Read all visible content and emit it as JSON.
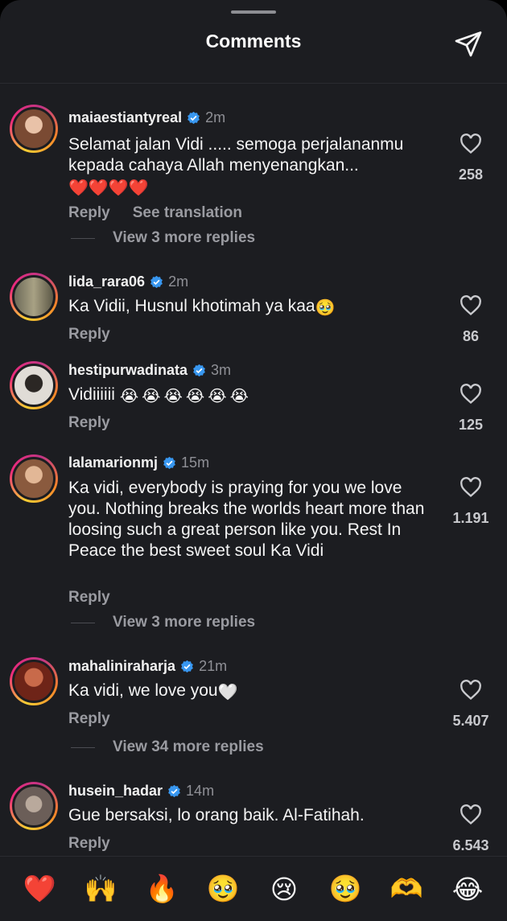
{
  "header": {
    "title": "Comments",
    "share_icon": "paper-plane-icon"
  },
  "comments": [
    {
      "username": "maiaestiantyreal",
      "verified": true,
      "time": "2m",
      "text": "Selamat jalan Vidi ..... semoga perjalananmu kepada cahaya Allah menyenangkan...",
      "text_emoji": "❤️❤️❤️❤️",
      "reply": "Reply",
      "translate": "See translation",
      "view_replies": "View 3 more replies",
      "likes": "258",
      "avatar_color": "#c9937a"
    },
    {
      "username": "lida_rara06",
      "verified": true,
      "time": "2m",
      "text": "Ka Vidii, Husnul khotimah ya kaa",
      "text_emoji": "🥹",
      "reply": "Reply",
      "likes": "86",
      "avatar_color": "#5d5a4a"
    },
    {
      "username": "hestipurwadinata",
      "verified": true,
      "time": "3m",
      "text": "Vidiiiiii",
      "text_emoji": "😭😭😭😭😭😭",
      "reply": "Reply",
      "likes": "125",
      "avatar_color": "#d7d2cc"
    },
    {
      "username": "lalamarionmj",
      "verified": true,
      "time": "15m",
      "text": "Ka vidi, everybody is praying for you we love you. Nothing breaks the worlds heart more than loosing such a great person like you. Rest In Peace the best sweet soul Ka Vidi",
      "reply": "Reply",
      "view_replies": "View 3 more replies",
      "likes": "1.191",
      "avatar_color": "#b38463"
    },
    {
      "username": "mahaliniraharja",
      "verified": true,
      "time": "21m",
      "text": "Ka vidi, we love you",
      "text_emoji": "🤍",
      "reply": "Reply",
      "view_replies": "View 34 more replies",
      "likes": "5.407",
      "avatar_color": "#a8432a"
    },
    {
      "username": "husein_hadar",
      "verified": true,
      "time": "14m",
      "text": "Gue bersaksi, lo orang baik. Al-Fatihah.",
      "reply": "Reply",
      "likes": "6.543",
      "avatar_color": "#7a6d66"
    }
  ],
  "reactions": [
    "❤️",
    "🙌",
    "🔥",
    "🥹",
    "😢",
    "🥹",
    "🫶",
    "😂"
  ],
  "colors": {
    "background": "#1c1d21",
    "verified": "#3897f0",
    "muted": "#9a9ba1"
  }
}
